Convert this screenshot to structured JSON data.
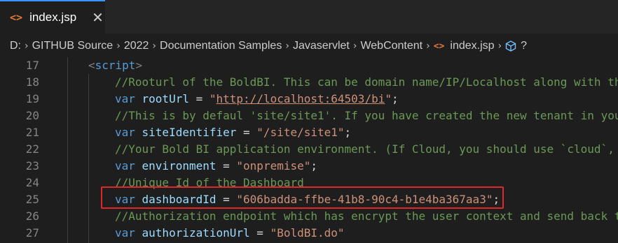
{
  "tab": {
    "icon": "<>",
    "title": "index.jsp",
    "close": "✕"
  },
  "breadcrumb": {
    "parts": [
      "D:",
      "GITHUB Source",
      "2022",
      "Documentation Samples",
      "Javaservlet",
      "WebContent"
    ],
    "file": "index.jsp",
    "symbol": "?"
  },
  "lines": [
    {
      "num": "17",
      "indent": 0,
      "tokens": [
        [
          "tag",
          "<"
        ],
        [
          "tagname",
          "script"
        ],
        [
          "tag",
          ">"
        ]
      ]
    },
    {
      "num": "18",
      "indent": 1,
      "tokens": [
        [
          "cmt",
          "//Rooturl of the BoldBI. This can be domain name/IP/Localhost along with the"
        ]
      ]
    },
    {
      "num": "19",
      "indent": 1,
      "tokens": [
        [
          "kw",
          "var "
        ],
        [
          "id",
          "rootUrl"
        ],
        [
          "op",
          " = "
        ],
        [
          "str",
          "\""
        ],
        [
          "str url",
          "http://localhost:64503/bi"
        ],
        [
          "str",
          "\""
        ],
        [
          "op",
          ";"
        ]
      ]
    },
    {
      "num": "20",
      "indent": 1,
      "tokens": [
        [
          "cmt",
          "//This is by defaul 'site/site1'. If you have created the new tenant in your"
        ]
      ]
    },
    {
      "num": "21",
      "indent": 1,
      "tokens": [
        [
          "kw",
          "var "
        ],
        [
          "id",
          "siteIdentifier"
        ],
        [
          "op",
          " = "
        ],
        [
          "str",
          "\"/site/site1\""
        ],
        [
          "op",
          ";"
        ]
      ]
    },
    {
      "num": "22",
      "indent": 1,
      "tokens": [
        [
          "cmt",
          "//Your Bold BI application environment. (If Cloud, you should use `cloud`, i"
        ]
      ]
    },
    {
      "num": "23",
      "indent": 1,
      "tokens": [
        [
          "kw",
          "var "
        ],
        [
          "id",
          "environment"
        ],
        [
          "op",
          " = "
        ],
        [
          "str",
          "\"onpremise\""
        ],
        [
          "op",
          ";"
        ]
      ]
    },
    {
      "num": "24",
      "indent": 1,
      "tokens": [
        [
          "cmt",
          "//Unique Id of the Dashboard"
        ]
      ]
    },
    {
      "num": "25",
      "indent": 1,
      "tokens": [
        [
          "kw",
          "var "
        ],
        [
          "id",
          "dashboardId"
        ],
        [
          "op",
          " = "
        ],
        [
          "str",
          "\"606badda-ffbe-41b8-90c4-b1e4ba367aa3\""
        ],
        [
          "op",
          ";"
        ]
      ]
    },
    {
      "num": "26",
      "indent": 1,
      "tokens": [
        [
          "cmt",
          "//Authorization endpoint which has encrypt the user context and send back to"
        ]
      ]
    },
    {
      "num": "27",
      "indent": 1,
      "tokens": [
        [
          "kw",
          "var "
        ],
        [
          "id",
          "authorizationUrl"
        ],
        [
          "op",
          " = "
        ],
        [
          "str",
          "\"BoldBI.do\""
        ]
      ]
    }
  ]
}
